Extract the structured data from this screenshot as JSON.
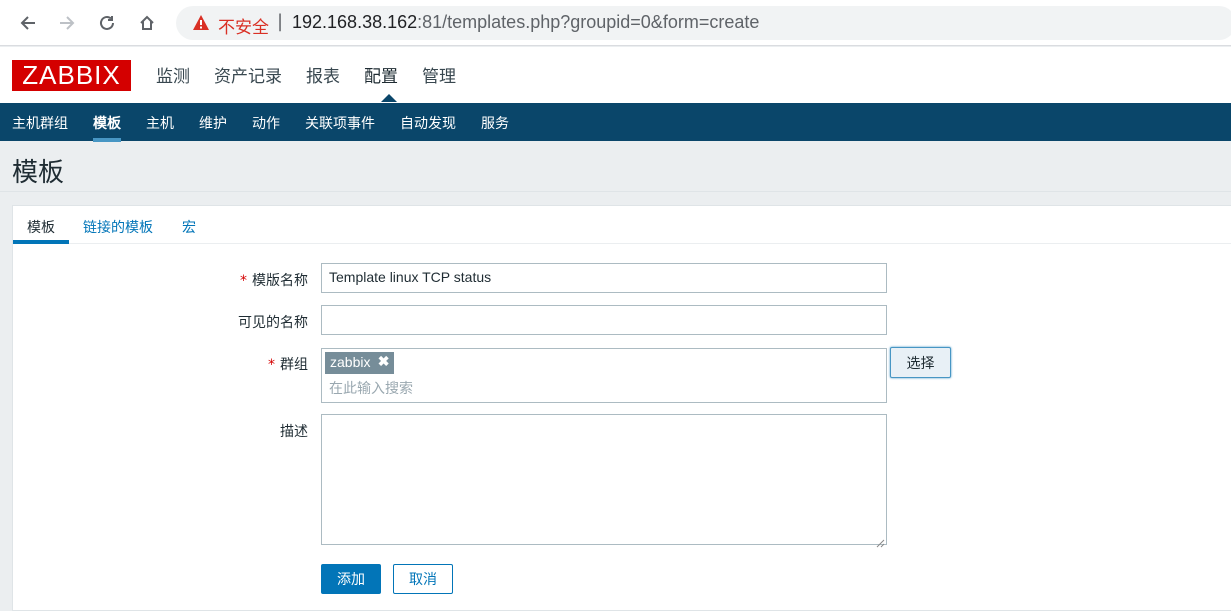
{
  "browser": {
    "insecure_label": "不安全",
    "separator": "|",
    "url_host": "192.168.38.162",
    "url_port": ":81",
    "url_path": "/templates.php?groupid=0&form=create"
  },
  "header": {
    "logo": "ZABBIX",
    "menu": [
      "监测",
      "资产记录",
      "报表",
      "配置",
      "管理"
    ],
    "active_menu": "配置"
  },
  "submenu": {
    "items": [
      "主机群组",
      "模板",
      "主机",
      "维护",
      "动作",
      "关联项事件",
      "自动发现",
      "服务"
    ],
    "active": "模板"
  },
  "page": {
    "title": "模板"
  },
  "tabs": [
    "模板",
    "链接的模板",
    "宏"
  ],
  "form": {
    "template_name_label": "模版名称",
    "template_name_value": "Template linux TCP  status",
    "visible_name_label": "可见的名称",
    "visible_name_value": "",
    "groups_label": "群组",
    "group_chip": "zabbix",
    "chip_remove": "✖",
    "groups_placeholder": "在此输入搜索",
    "select_button": "选择",
    "description_label": "描述",
    "description_value": "",
    "required_mark": "*",
    "add_button": "添加",
    "cancel_button": "取消"
  },
  "colors": {
    "brand_red": "#d40000",
    "nav_blue": "#0a466a",
    "link_blue": "#0275b8"
  }
}
